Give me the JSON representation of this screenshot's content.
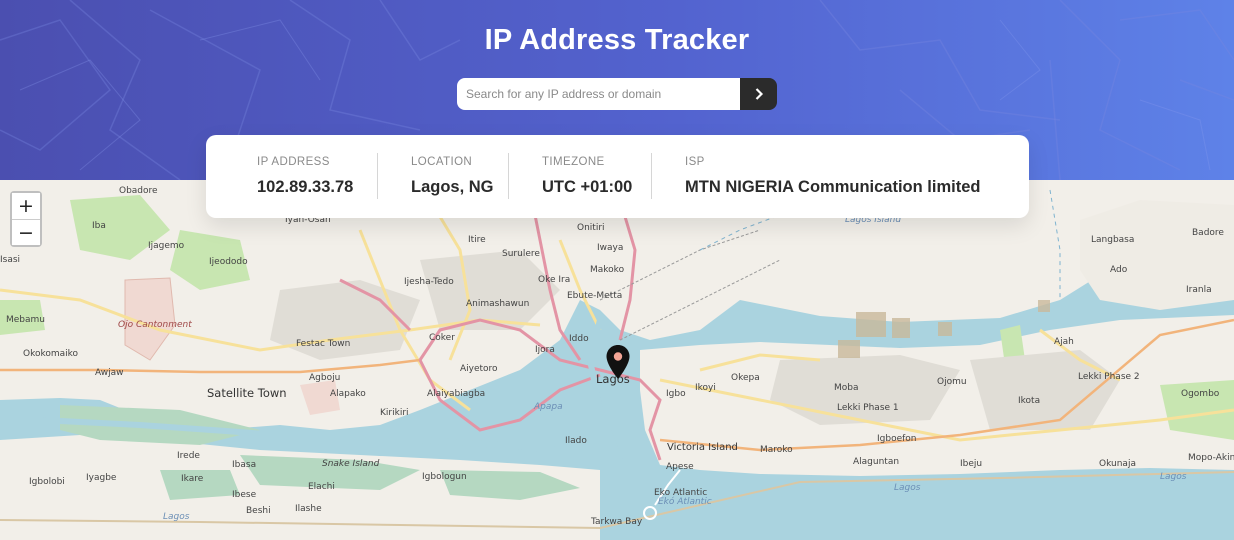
{
  "header": {
    "title": "IP Address Tracker"
  },
  "search": {
    "placeholder": "Search for any IP address or domain",
    "value": "",
    "submit_icon": "chevron-right-icon"
  },
  "info": {
    "ip": {
      "label": "IP ADDRESS",
      "value": "102.89.33.78"
    },
    "location": {
      "label": "LOCATION",
      "value": "Lagos, NG"
    },
    "timezone": {
      "label": "TIMEZONE",
      "value": "UTC +01:00"
    },
    "isp": {
      "label": "ISP",
      "value": "MTN NIGERIA Communication limited"
    }
  },
  "map": {
    "zoom_in": "+",
    "zoom_out": "−",
    "marker_icon": "location-pin-icon",
    "water_color": "#aad3df",
    "land_color": "#f2efe9",
    "labels": {
      "obadore": "Obadore",
      "iba": "Iba",
      "ijegemo": "Ijagemo",
      "isasi": "Isasi",
      "ijeododo": "Ijeododo",
      "iyan_osan": "Iyan-Osan",
      "itire": "Itire",
      "surulere": "Surulere",
      "onitiri": "Onitiri",
      "iwaya": "Iwaya",
      "lagos_island_top": "Lagos Island",
      "langbasa": "Langbasa",
      "badore": "Badore",
      "ado": "Ado",
      "iranla": "Iranla",
      "oke_ira": "Oke Ira",
      "makoko": "Makoko",
      "ijesha_tedo": "Ijesha-Tedo",
      "ebute_metta": "Ebute-Metta",
      "animashawun": "Animashawun",
      "mebamu": "Mebamu",
      "ojo_cantonment": "Ojo Cantonment",
      "okokomaiko": "Okokomaiko",
      "awjaw": "Awjaw",
      "festac_town": "Festac Town",
      "coker": "Coker",
      "ijora": "Ijora",
      "iddo": "Iddo",
      "aiyetoro": "Aiyetoro",
      "agboju": "Agboju",
      "satellite_town": "Satellite Town",
      "alapako": "Alapako",
      "alaiyabiagba": "Alaiyabiagba",
      "kirikiri": "Kirikiri",
      "apapa": "Apapa",
      "lagos": "Lagos",
      "igbo": "Igbo",
      "ikoyi": "Ikoyi",
      "okepa": "Okepa",
      "moba": "Moba",
      "ojomu": "Ojomu",
      "ajah": "Ajah",
      "lekki_phase_1": "Lekki Phase 1",
      "lekki_phase_2": "Lekki Phase 2",
      "ikota": "Ikota",
      "ogombo": "Ogombo",
      "ilado": "Ilado",
      "victoria_island": "Victoria Island",
      "maroko": "Maroko",
      "igboefon": "Igboefon",
      "alaguntan": "Alaguntan",
      "ibeju": "Ibeju",
      "okunaja": "Okunaja",
      "mopo_akin": "Mopo-Akin",
      "irede": "Irede",
      "ibasa": "Ibasa",
      "snake_island": "Snake Island",
      "igbolobi": "Igbolobi",
      "iyagbe": "Iyagbe",
      "ikare": "Ikare",
      "elachi": "Elachi",
      "igbologun": "Igbologun",
      "ibese": "Ibese",
      "apese": "Apese",
      "eko_atlantic": "Eko Atlantic",
      "eko_atlantic_alt": "Ekó Atlantic",
      "beshi": "Beshi",
      "ilashe": "Ilashe",
      "lagos_lagoon_sw": "Lagos",
      "lagos_lagoon_se": "Lagos",
      "lagos_lagoon_e": "Lagos",
      "tarkwa_bay": "Tarkwa Bay"
    }
  }
}
